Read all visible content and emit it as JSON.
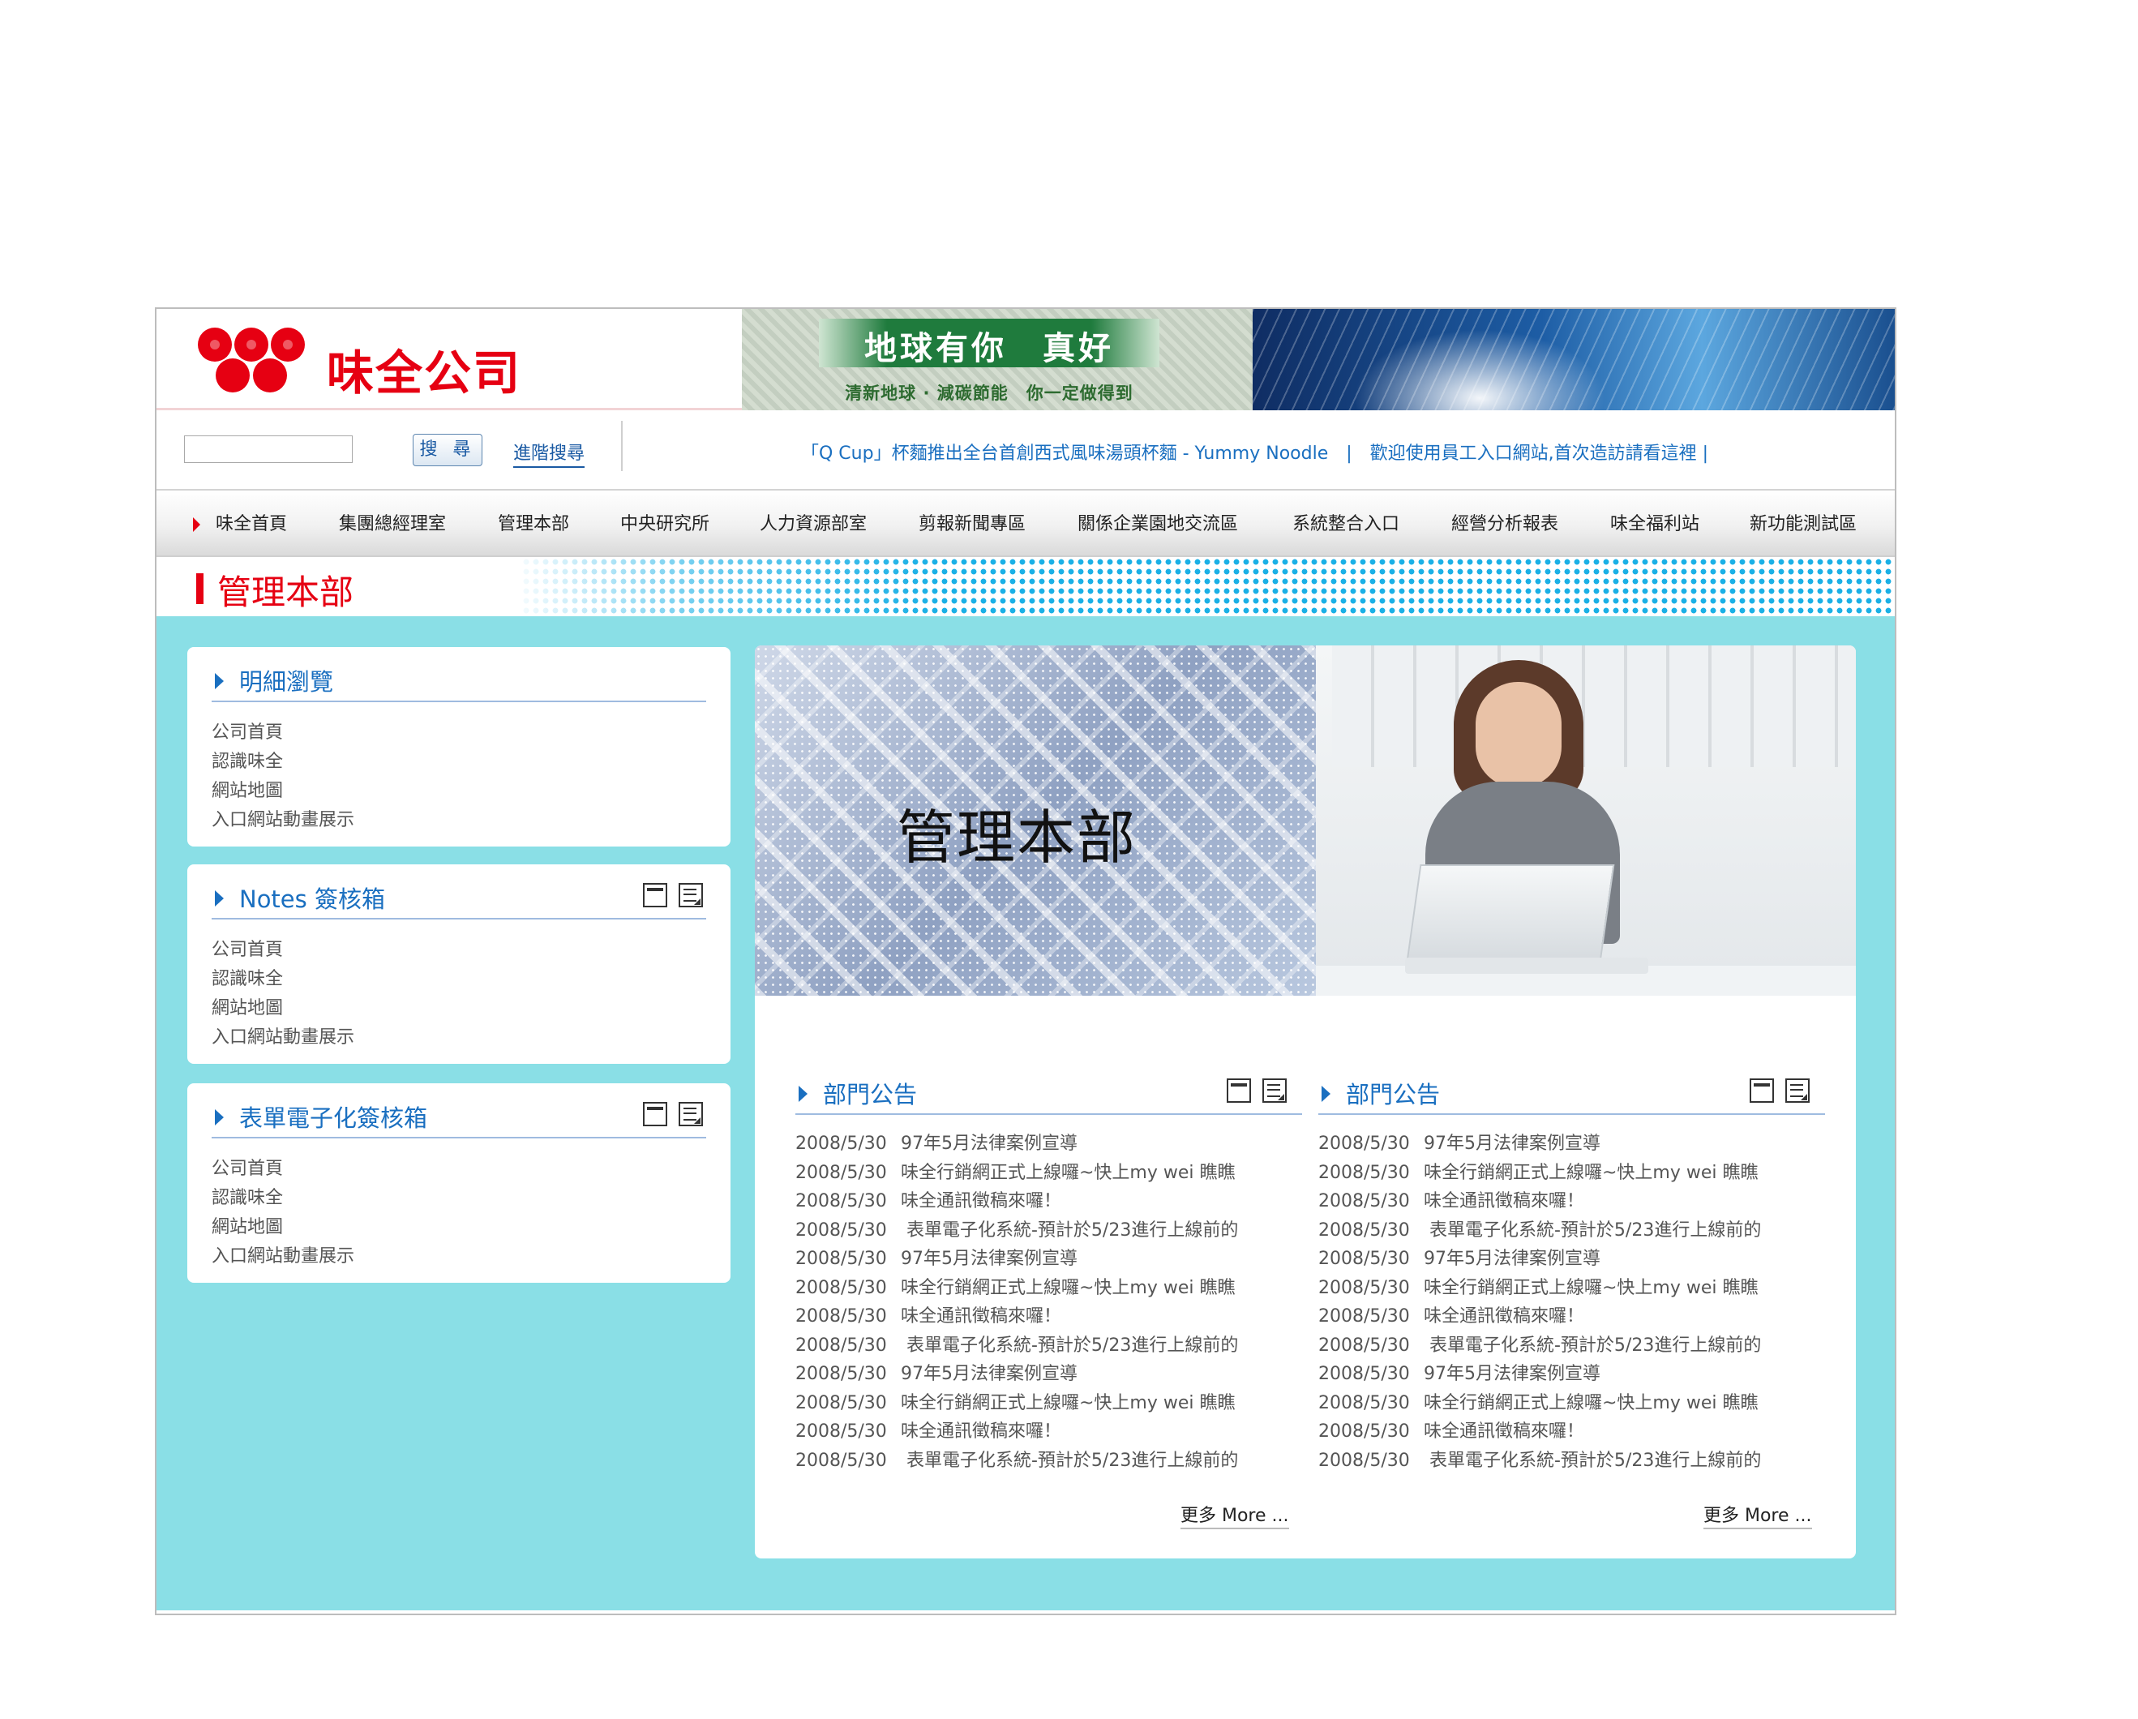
{
  "brand": {
    "name": "味全公司",
    "accent": "#e60012"
  },
  "banner": {
    "slogan": "地球有你　真好",
    "subline": "清新地球 · 減碳節能　你一定做得到"
  },
  "search": {
    "value": "",
    "button_label": "搜 尋",
    "advanced_label": "進階搜尋"
  },
  "ticker": "「Q Cup」杯麵推出全台首創西式風味湯頭杯麵 - Yummy Noodle　|　歡迎使用員工入口網站,首次造訪請看這裡 |",
  "nav": {
    "items": [
      "味全首頁",
      "集團總經理室",
      "管理本部",
      "中央研究所",
      "人力資源部室",
      "剪報新聞專區",
      "關係企業園地交流區",
      "系統整合入口",
      "經營分析報表",
      "味全福利站",
      "新功能測試區"
    ]
  },
  "page_title": "管理本部",
  "sidebar": {
    "boxes": [
      {
        "title": "明細瀏覽",
        "links": [
          "公司首頁",
          "認識味全",
          "網站地圖",
          "入口網站動畫展示"
        ]
      },
      {
        "title": "Notes 簽核箱",
        "links": [
          "公司首頁",
          "認識味全",
          "網站地圖",
          "入口網站動畫展示"
        ]
      },
      {
        "title": "表單電子化簽核箱",
        "links": [
          "公司首頁",
          "認識味全",
          "網站地圖",
          "入口網站動畫展示"
        ]
      }
    ]
  },
  "hero": {
    "title": "管理本部"
  },
  "announcements": [
    {
      "title": "部門公告",
      "more_label": "更多 More ...",
      "items": [
        {
          "date": "2008/5/30",
          "text": "97年5月法律案例宣導"
        },
        {
          "date": "2008/5/30",
          "text": "味全行銷網正式上線囉~快上my wei 瞧瞧"
        },
        {
          "date": "2008/5/30",
          "text": "味全通訊徵稿來囉！"
        },
        {
          "date": "2008/5/30",
          "text": " 表單電子化系統-預計於5/23進行上線前的"
        },
        {
          "date": "2008/5/30",
          "text": "97年5月法律案例宣導"
        },
        {
          "date": "2008/5/30",
          "text": "味全行銷網正式上線囉~快上my wei 瞧瞧"
        },
        {
          "date": "2008/5/30",
          "text": "味全通訊徵稿來囉！"
        },
        {
          "date": "2008/5/30",
          "text": " 表單電子化系統-預計於5/23進行上線前的"
        },
        {
          "date": "2008/5/30",
          "text": "97年5月法律案例宣導"
        },
        {
          "date": "2008/5/30",
          "text": "味全行銷網正式上線囉~快上my wei 瞧瞧"
        },
        {
          "date": "2008/5/30",
          "text": "味全通訊徵稿來囉！"
        },
        {
          "date": "2008/5/30",
          "text": " 表單電子化系統-預計於5/23進行上線前的"
        }
      ]
    },
    {
      "title": "部門公告",
      "more_label": "更多 More ...",
      "items": [
        {
          "date": "2008/5/30",
          "text": "97年5月法律案例宣導"
        },
        {
          "date": "2008/5/30",
          "text": "味全行銷網正式上線囉~快上my wei 瞧瞧"
        },
        {
          "date": "2008/5/30",
          "text": "味全通訊徵稿來囉！"
        },
        {
          "date": "2008/5/30",
          "text": " 表單電子化系統-預計於5/23進行上線前的"
        },
        {
          "date": "2008/5/30",
          "text": "97年5月法律案例宣導"
        },
        {
          "date": "2008/5/30",
          "text": "味全行銷網正式上線囉~快上my wei 瞧瞧"
        },
        {
          "date": "2008/5/30",
          "text": "味全通訊徵稿來囉！"
        },
        {
          "date": "2008/5/30",
          "text": " 表單電子化系統-預計於5/23進行上線前的"
        },
        {
          "date": "2008/5/30",
          "text": "97年5月法律案例宣導"
        },
        {
          "date": "2008/5/30",
          "text": "味全行銷網正式上線囉~快上my wei 瞧瞧"
        },
        {
          "date": "2008/5/30",
          "text": "味全通訊徵稿來囉！"
        },
        {
          "date": "2008/5/30",
          "text": " 表單電子化系統-預計於5/23進行上線前的"
        }
      ]
    }
  ],
  "colors": {
    "content_bg": "#8adfe6",
    "link_blue": "#1a6fc0",
    "brand_red": "#e60012"
  }
}
